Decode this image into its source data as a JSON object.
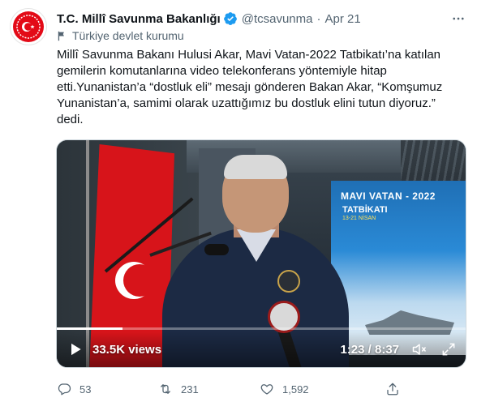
{
  "tweet": {
    "author_name": "T.C. Millî Savunma Bakanlığı",
    "handle": "@tcsavunma",
    "separator": "·",
    "date": "Apr 21",
    "account_label": "Türkiye devlet kurumu",
    "text": "Millî Savunma Bakanı Hulusi Akar, Mavi Vatan-2022 Tatbikatı’na katılan gemilerin komutanlarına video telekonferans yöntemiyle hitap etti.Yunanistan’a “dostluk eli” mesajı gönderen Bakan Akar, “Komşumuz Yunanistan’a, samimi olarak uzattığımız bu dostluk elini tutun diyoruz.” dedi."
  },
  "video": {
    "views": "33.5K views",
    "time": "1:23 / 8:37",
    "progress": 0.161,
    "poster_title": "MAVI VATAN - 2022",
    "poster_subtitle": "TATBİKATI",
    "poster_date": "13-21 NİSAN"
  },
  "actions": {
    "replies": "53",
    "retweets": "231",
    "likes": "1,592"
  },
  "colors": {
    "secondary_text": "#536471",
    "verified_blue": "#1d9bf0",
    "flag_red": "#d7141a"
  },
  "icons": [
    "ministry-emblem-icon",
    "verified-badge-icon",
    "more-icon",
    "flag-icon",
    "play-icon",
    "volume-icon",
    "fullscreen-icon",
    "reply-icon",
    "retweet-icon",
    "like-icon",
    "share-icon"
  ]
}
